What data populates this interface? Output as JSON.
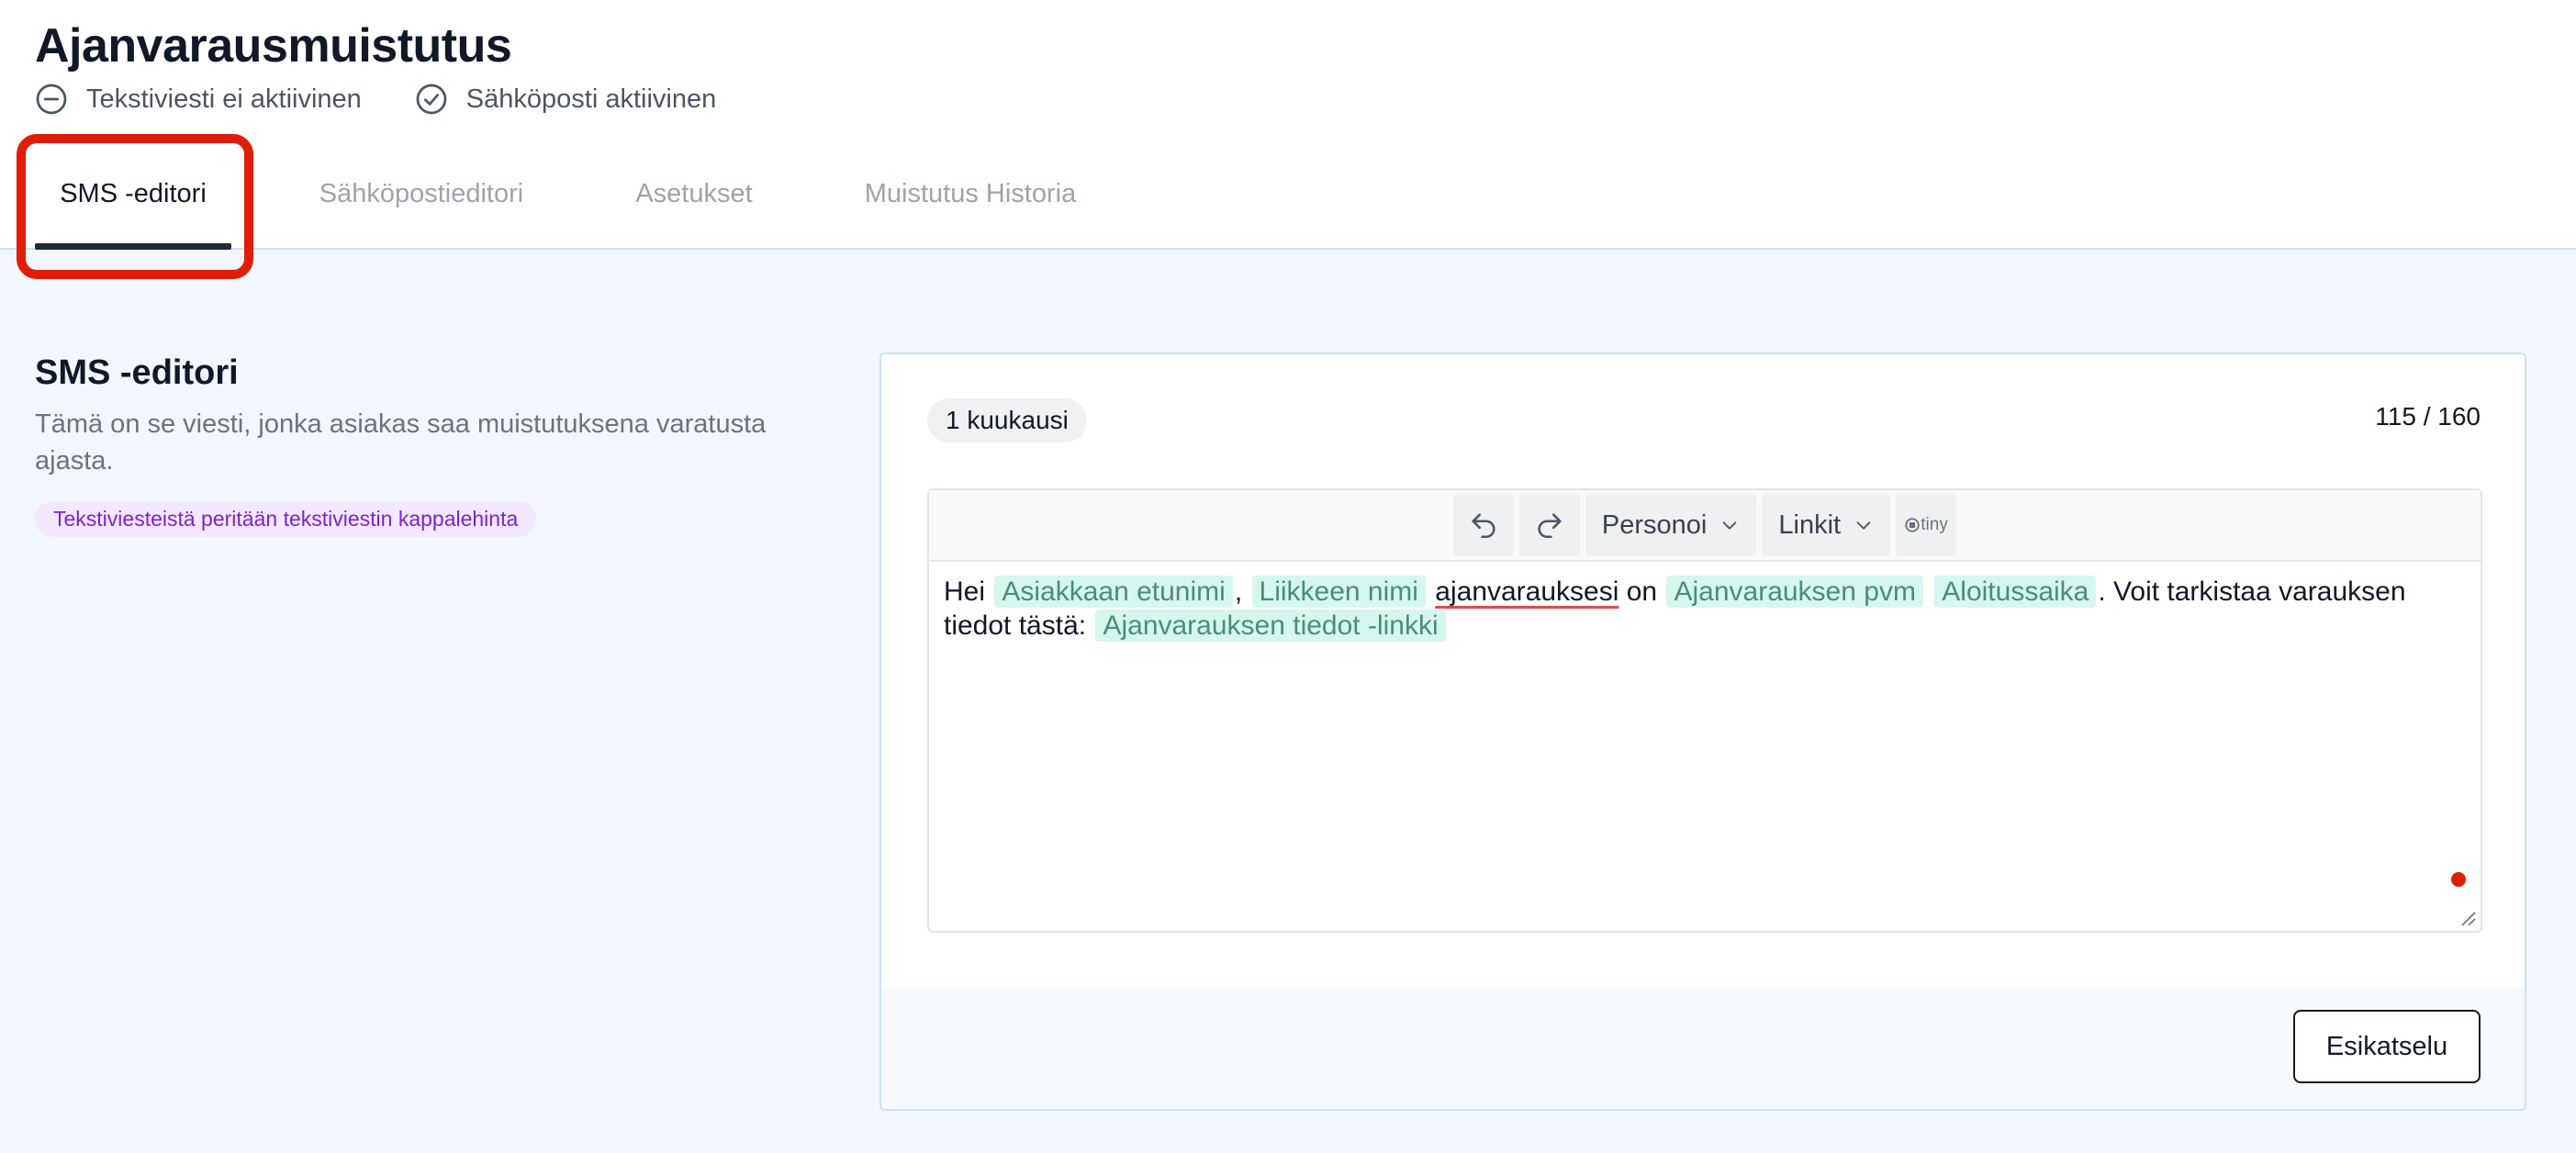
{
  "page": {
    "title": "Ajanvarausmuistutus",
    "status": [
      {
        "label": "Tekstiviesti ei aktiivinen",
        "icon": "minus-circle-icon",
        "active": false
      },
      {
        "label": "Sähköposti aktiivinen",
        "icon": "check-circle-icon",
        "active": true
      }
    ]
  },
  "tabs": [
    {
      "label": "SMS -editori",
      "active": true
    },
    {
      "label": "Sähköpostieditori",
      "active": false
    },
    {
      "label": "Asetukset",
      "active": false
    },
    {
      "label": "Muistutus Historia",
      "active": false
    }
  ],
  "section": {
    "title": "SMS -editori",
    "description": "Tämä on se viesti, jonka asiakas saa muistutuksena varatusta ajasta.",
    "pill": "Tekstiviesteistä peritään tekstiviestin kappalehinta"
  },
  "panel": {
    "badge": "1 kuukausi",
    "counter": "115 / 160",
    "toolbar": {
      "undo_icon": "undo-icon",
      "redo_icon": "redo-icon",
      "personalize_label": "Personoi",
      "links_label": "Linkit",
      "brand_label": "tiny"
    },
    "message": {
      "greeting": "Hei",
      "var_first_name": "Asiakkaan etunimi",
      "comma": ",",
      "var_business_name": "Liikkeen nimi",
      "word_booking": "ajanvarauksesi",
      "word_on": "on",
      "var_date": "Ajanvarauksen pvm",
      "var_start_time": "Aloitussaika",
      "sentence_two": ". Voit tarkistaa varauksen tiedot tästä:",
      "var_details_link": "Ajanvarauksen tiedot -linkki"
    },
    "preview_label": "Esikatselu"
  },
  "colors": {
    "accent_dark": "#1f2937",
    "highlight_red": "#e11d07",
    "variable_bg": "#d5f7ef",
    "pill_bg": "#f3e8ff",
    "pill_text": "#7e22ce"
  }
}
